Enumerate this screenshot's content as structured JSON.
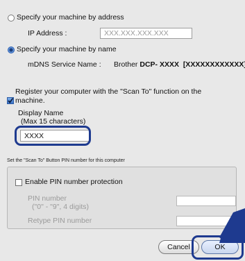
{
  "dialog": {
    "address_option": {
      "label": "Specify your machine by address",
      "ip_label": "IP Address :",
      "ip_placeholder": "XXX.XXX.XXX.XXX"
    },
    "name_option": {
      "label": "Specify your machine by name",
      "mdns_label": "mDNS Service Name :",
      "mdns_value_prefix": "Brother ",
      "mdns_value_model": "DCP- XXXX",
      "mdns_value_serial": "[XXXXXXXXXXXX]"
    },
    "register": {
      "line1": "Register your computer with the \"Scan To\" function on the",
      "line2": "machine.",
      "display_name_label": "Display Name",
      "display_name_hint": "(Max 15 characters)",
      "display_name_value": "XXXX"
    },
    "pin_section": {
      "title": "Set the \"Scan To\" Button PIN number for this computer",
      "enable_label": "Enable PIN number protection",
      "pin_label": "PIN number",
      "pin_hint": "(\"0\" - \"9\",  4 digits)",
      "retype_label": "Retype PIN number"
    },
    "buttons": {
      "cancel": "Cancel",
      "ok": "OK"
    }
  },
  "colors": {
    "callout": "#1e3a8f",
    "arrow": "#1e3a8f",
    "dialog_bg": "#e8e8e8"
  }
}
